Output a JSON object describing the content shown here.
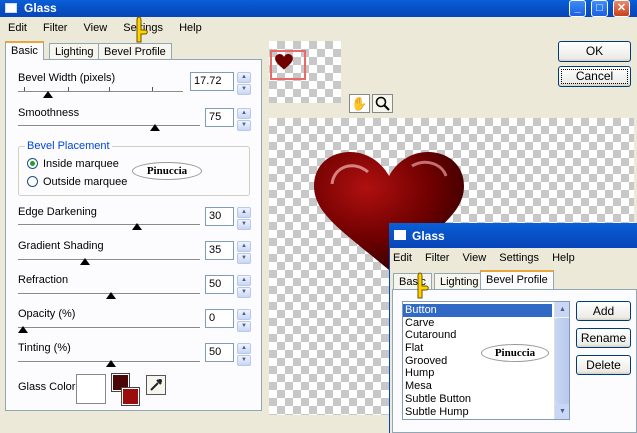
{
  "dialog_back": {
    "title": "Glass",
    "menu": [
      "Edit",
      "Filter",
      "View",
      "Settings",
      "Help"
    ],
    "tabs": [
      "Basic",
      "Lighting",
      "Bevel Profile"
    ],
    "ok_label": "OK",
    "cancel_label": "Cancel",
    "fields": {
      "bevel_width": {
        "label": "Bevel Width (pixels)",
        "value": "17.72"
      },
      "smoothness": {
        "label": "Smoothness",
        "value": "75"
      },
      "edge_darkening": {
        "label": "Edge Darkening",
        "value": "30"
      },
      "gradient_shading": {
        "label": "Gradient Shading",
        "value": "35"
      },
      "refraction": {
        "label": "Refraction",
        "value": "50"
      },
      "opacity": {
        "label": "Opacity (%)",
        "value": "0"
      },
      "tinting": {
        "label": "Tinting (%)",
        "value": "50"
      }
    },
    "bevel_placement": {
      "legend": "Bevel Placement",
      "inside": "Inside marquee",
      "outside": "Outside marquee",
      "selected": "inside"
    },
    "glass_color_label": "Glass Color",
    "glass_color": "#5a0a0a",
    "watermark": "Pinuccia"
  },
  "dialog_front": {
    "title": "Glass",
    "menu": [
      "Edit",
      "Filter",
      "View",
      "Settings",
      "Help"
    ],
    "tabs": [
      "Basic",
      "Lighting",
      "Bevel Profile"
    ],
    "profiles": [
      "Button",
      "Carve",
      "Cutaround",
      "Flat",
      "Grooved",
      "Hump",
      "Mesa",
      "Subtle Button",
      "Subtle Hump"
    ],
    "selected_profile": "Button",
    "add_label": "Add",
    "rename_label": "Rename",
    "delete_label": "Delete",
    "watermark": "Pinuccia"
  },
  "colors": {
    "heart": "#6e0000",
    "title_blue": "#0853c8",
    "selection": "#316ac5"
  }
}
